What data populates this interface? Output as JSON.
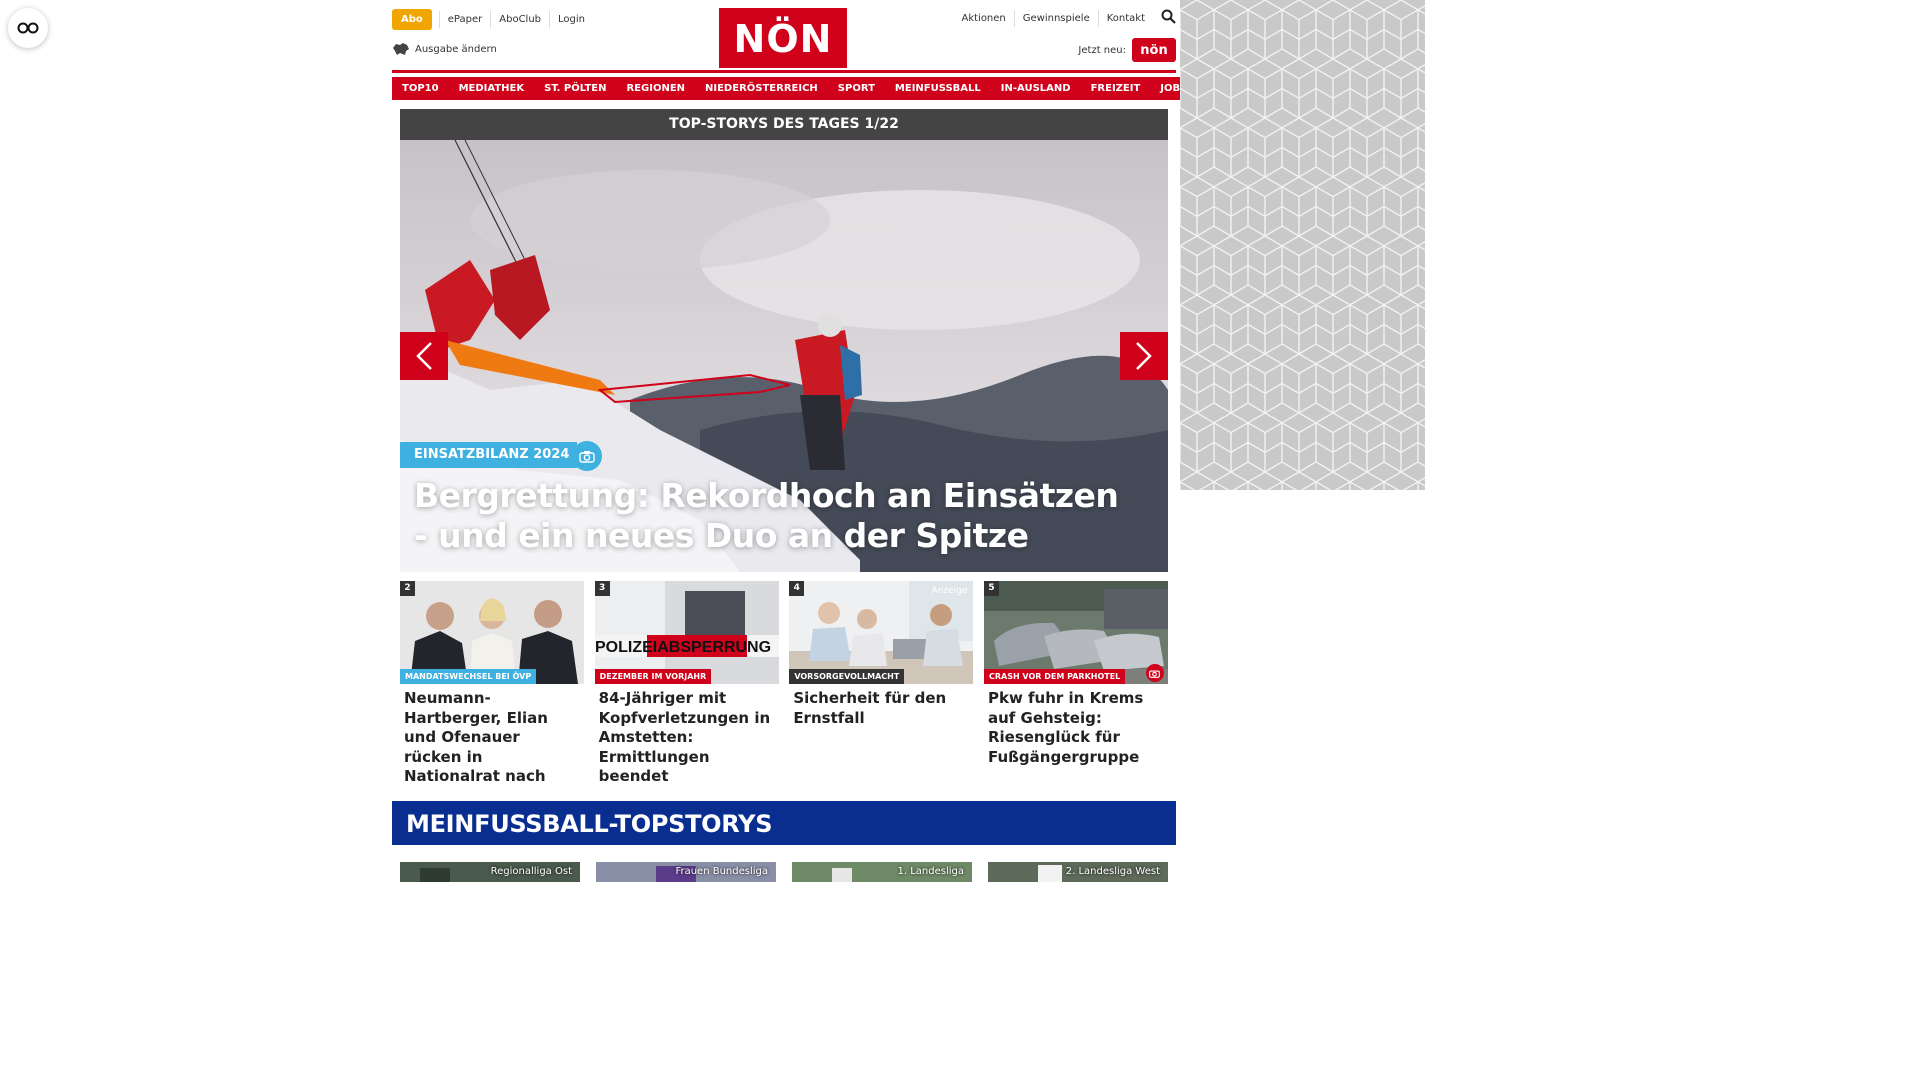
{
  "header": {
    "abo": "Abo",
    "left_links": [
      "ePaper",
      "AboClub",
      "Login"
    ],
    "edition": "Ausgabe ändern",
    "logo": "NÖN",
    "right_links": [
      "Aktionen",
      "Gewinnspiele",
      "Kontakt"
    ],
    "jetzt_neu": "Jetzt neu:",
    "jetzt_badge": "nön"
  },
  "nav": [
    "TOP10",
    "MEDIATHEK",
    "ST. PÖLTEN",
    "REGIONEN",
    "NIEDERÖSTERREICH",
    "SPORT",
    "MEINFUSSBALL",
    "IN-AUSLAND",
    "FREIZEIT",
    "JOB & KARRIERE"
  ],
  "hero": {
    "bar": "TOP-STORYS DES TAGES 1/22",
    "kicker": "EINSATZBILANZ 2024",
    "title": "Bergrettung: Rekordhoch an Einsätzen - und ein neues Duo an der Spitze"
  },
  "teasers": [
    {
      "num": "2",
      "kicker": "MANDATSWECHSEL BEI ÖVP",
      "title": "Neumann-Hartberger, Elian und Ofenauer rücken in Nationalrat nach"
    },
    {
      "num": "3",
      "kicker": "DEZEMBER IM VORJAHR",
      "title": "84-Jähriger mit Kopfverletzungen in Amstetten: Ermittlungen beendet",
      "image_text": "POLIZEIABSPERRUNG"
    },
    {
      "num": "4",
      "kicker": "VORSORGEVOLLMACHT",
      "title": "Sicherheit für den Ernstfall",
      "badge": "Anzeige"
    },
    {
      "num": "5",
      "kicker": "CRASH VOR DEM PARKHOTEL",
      "title": "Pkw fuhr in Krems auf Gehsteig: Riesenglück für Fußgängergruppe"
    }
  ],
  "meinfussball": {
    "title": "MEINFUSSBALL-TOPSTORYS",
    "items": [
      "Regionalliga Ost",
      "Frauen Bundesliga",
      "1. Landesliga",
      "2. Landesliga West"
    ]
  },
  "colors": {
    "brand_red": "#d0021b",
    "accent_blue": "#3fb1e0",
    "abo_orange": "#f0a500",
    "navy": "#0a2e8f"
  }
}
